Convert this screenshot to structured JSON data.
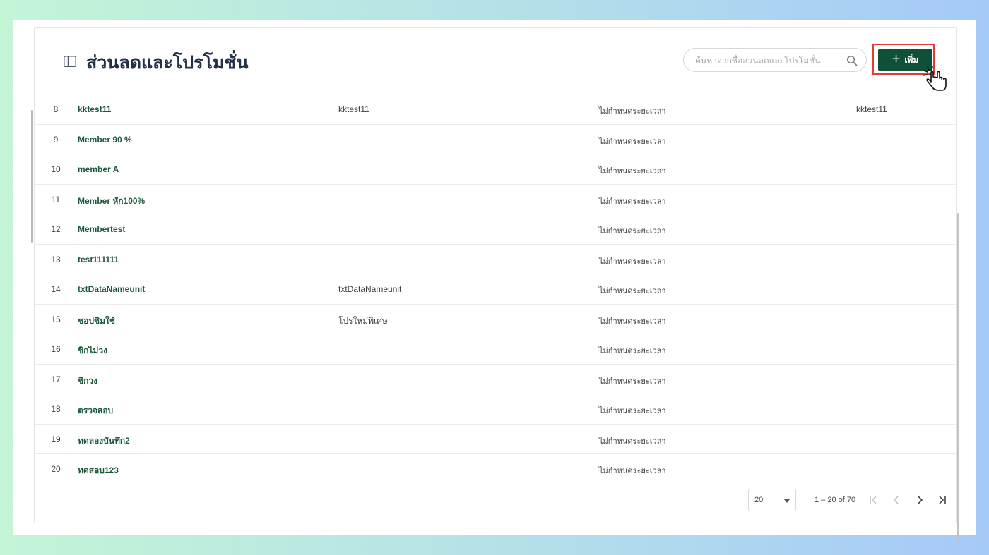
{
  "page": {
    "title": "ส่วนลดและโปรโมชั่น",
    "search_placeholder": "ค้นหาจากชื่อส่วนลดและโปรโมชั่น",
    "add_label": "เพิ่ม"
  },
  "table": {
    "rows": [
      {
        "num": "8",
        "name": "kktest11",
        "desc": "kktest11",
        "period": "ไม่กำหนดระยะเวลา",
        "code": "kktest11"
      },
      {
        "num": "9",
        "name": "Member 90 %",
        "desc": "",
        "period": "ไม่กำหนดระยะเวลา",
        "code": ""
      },
      {
        "num": "10",
        "name": "member A",
        "desc": "",
        "period": "ไม่กำหนดระยะเวลา",
        "code": ""
      },
      {
        "num": "11",
        "name": "Member หัก100%",
        "desc": "",
        "period": "ไม่กำหนดระยะเวลา",
        "code": ""
      },
      {
        "num": "12",
        "name": "Membertest",
        "desc": "",
        "period": "ไม่กำหนดระยะเวลา",
        "code": ""
      },
      {
        "num": "13",
        "name": "test111111",
        "desc": "",
        "period": "ไม่กำหนดระยะเวลา",
        "code": ""
      },
      {
        "num": "14",
        "name": "txtDataNameunit",
        "desc": "txtDataNameunit",
        "period": "ไม่กำหนดระยะเวลา",
        "code": ""
      },
      {
        "num": "15",
        "name": "ชอปชิมใช้",
        "desc": "โปรใหม่พิเศษ",
        "period": "ไม่กำหนดระยะเวลา",
        "code": ""
      },
      {
        "num": "16",
        "name": "ชิกไม่วง",
        "desc": "",
        "period": "ไม่กำหนดระยะเวลา",
        "code": ""
      },
      {
        "num": "17",
        "name": "ชิกวง",
        "desc": "",
        "period": "ไม่กำหนดระยะเวลา",
        "code": ""
      },
      {
        "num": "18",
        "name": "ตรวจสอบ",
        "desc": "",
        "period": "ไม่กำหนดระยะเวลา",
        "code": ""
      },
      {
        "num": "19",
        "name": "ทดลองบันทึก2",
        "desc": "",
        "period": "ไม่กำหนดระยะเวลา",
        "code": ""
      },
      {
        "num": "20",
        "name": "ทดสอบ123",
        "desc": "",
        "period": "ไม่กำหนดระยะเวลา",
        "code": ""
      }
    ]
  },
  "pagination": {
    "page_size": "20",
    "range": "1 – 20 of 70"
  },
  "colors": {
    "primary": "#0e5138",
    "name_text": "#1b5a3c",
    "highlight": "#e53935"
  },
  "icons": [
    "table-icon",
    "search-icon",
    "plus-icon",
    "hand-cursor-icon",
    "first-page-icon",
    "prev-page-icon",
    "next-page-icon",
    "last-page-icon"
  ]
}
